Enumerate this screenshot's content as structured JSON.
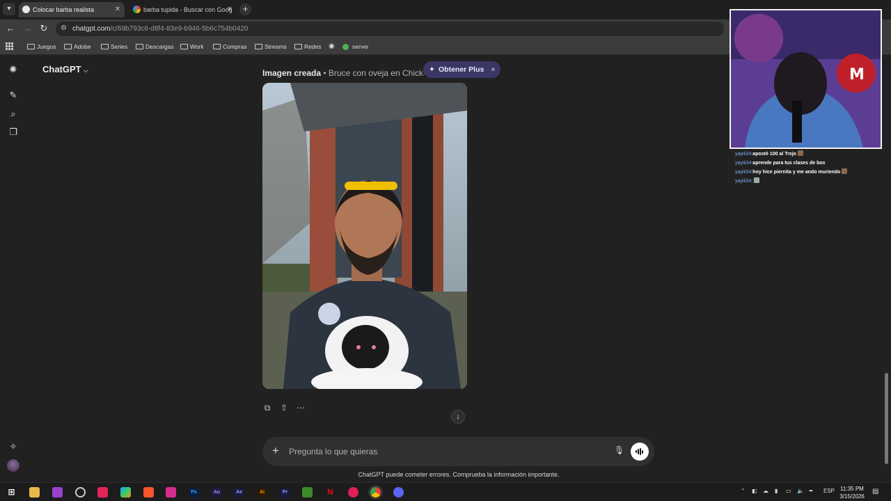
{
  "browser": {
    "tabs": [
      {
        "title": "Colocar barba realista",
        "active": true
      },
      {
        "title": "barba tupida - Buscar con Goog",
        "active": false
      }
    ],
    "new_tab": "+",
    "url_host": "chatgpt.com",
    "url_path": "/c/69b793c6-d8f4-83e9-b946-5b6c754b0420",
    "bookmarks": [
      "Juegos",
      "Adobe",
      "Series",
      "Descargas",
      "Work",
      "Compras",
      "Streams",
      "Redes",
      "server"
    ]
  },
  "chatgpt": {
    "brand": "ChatGPT",
    "image_label": "Imagen creada",
    "image_separator": " • ",
    "image_caption": "Bruce con oveja en Chick-fil-A",
    "get_plus": "Obtener Plus",
    "close": "×",
    "composer_placeholder": "Pregunta lo que quieras",
    "disclaimer": "ChatGPT puede cometer errores. Comprueba la información importante."
  },
  "stream_chat": [
    {
      "user": "yayiii34:",
      "message": "aposté 100 al Trejo",
      "emote": true
    },
    {
      "user": "yayiii34:",
      "message": "aprende para tus clases de box",
      "emote": false
    },
    {
      "user": "yayiii34:",
      "message": "hoy hice piernita y me ando muriendo",
      "emote": true
    },
    {
      "user": "yayiii34:",
      "message": "",
      "emote": true
    }
  ],
  "taskbar": {
    "language": "ESP",
    "time": "11:35 PM",
    "date": "3/15/2026",
    "apps": [
      "Ps",
      "Au",
      "Ae",
      "Ai",
      "Pr"
    ]
  },
  "colors": {
    "background": "#212121",
    "plus_pill": "#3b3764",
    "composer": "#303030"
  }
}
